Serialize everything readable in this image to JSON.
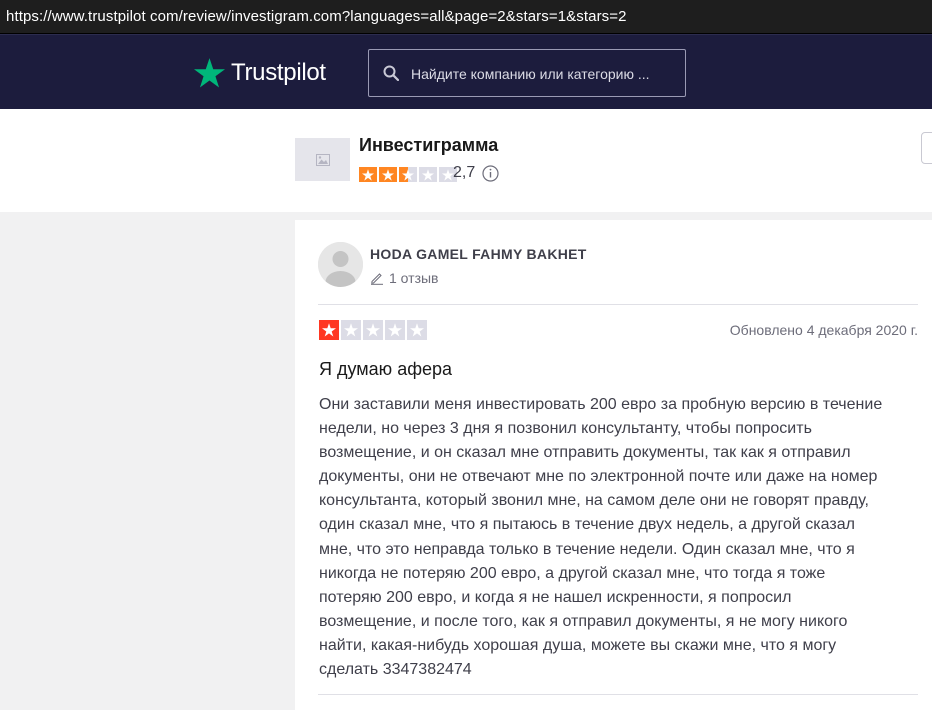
{
  "browser": {
    "url": "https://www.trustpilot com/review/investigram.com?languages=all&page=2&stars=1&stars=2"
  },
  "nav": {
    "brand": "Trustpilot",
    "search_placeholder": "Найдите компанию или категорию ...",
    "colors": {
      "nav_bg": "#1c1c3d",
      "brand_green": "#00b67a"
    }
  },
  "company": {
    "name": "Инвестиграмма",
    "score": "2,7",
    "stars": 2.5,
    "star_color": "#ff8622"
  },
  "review": {
    "reviewer_name": "HODA GAMEL FAHMY BAKHET",
    "review_count": "1 отзыв",
    "rating": 1,
    "rating_color": "#ff3722",
    "date": "Обновлено 4 декабря 2020 г.",
    "title": "Я думаю афера",
    "body_lines": [
      "Они заставили меня инвестировать 200 евро за пробную версию в течение",
      "недели, но через 3 дня я позвонил консультанту, чтобы попросить",
      "возмещение, и он сказал мне отправить документы, так как я отправил",
      "документы, они не отвечают мне по электронной почте или даже на номер",
      "консультанта, который звонил мне, на самом деле они не говорят правду,",
      "один сказал мне, что я пытаюсь в течение двух недель, а другой сказал",
      "мне, что это неправда только в течение недели. Один сказал мне, что я",
      "никогда не потеряю 200 евро, а другой сказал мне, что тогда я тоже",
      "потеряю 200 евро, и когда я не нашел искренности, я попросил",
      "возмещение, и после того, как я отправил документы, я не могу никого",
      "найти, какая-нибудь хорошая душа, можете вы скажи мне, что я могу",
      "сделать 3347382474"
    ]
  }
}
